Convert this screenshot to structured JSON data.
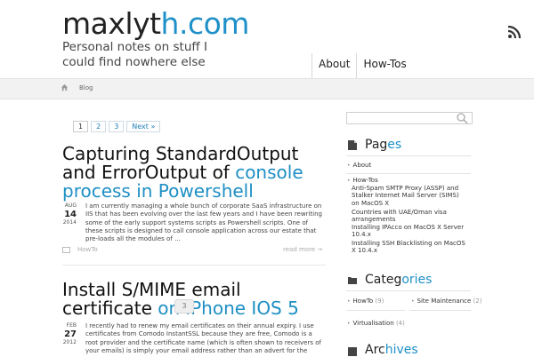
{
  "site": {
    "title_main": "maxlyt",
    "title_accent": "h.com",
    "tagline": "Personal notes on stuff I could find nowhere else"
  },
  "nav": {
    "items": [
      "About",
      "How-Tos"
    ]
  },
  "breadcrumb": {
    "label": "Blog"
  },
  "pagination": {
    "pages": [
      "1",
      "2",
      "3"
    ],
    "next": "Next »"
  },
  "posts": [
    {
      "title_plain": "Capturing StandardOutput and ErrorOutput of ",
      "title_link": "console process in Powershell",
      "month": "AUG",
      "day": "14",
      "year": "2014",
      "excerpt": "I am currently managing a whole bunch of corporate SaaS infrastructure on IIS that has been evolving over the last few years and I have been rewriting some of the early support systems scripts as Powershell scripts. One of these scripts is designed to call console application across our estate that pre-loads all the modules of …",
      "category": "HowTo",
      "read_more": "read more →"
    },
    {
      "title_plain": "Install S/MIME email certificate ",
      "title_link": "on iPhone IOS 5",
      "comments": "3",
      "month": "FEB",
      "day": "27",
      "year": "2012",
      "excerpt": "I recently had to renew my email certificates on their annual expiry. I use certificates from Comodo InstantSSL because they are free, Comodo is a root provider and the certificate name (which is often shown to receivers of your emails) is simply your email address rather than an advert for the"
    }
  ],
  "sidebar": {
    "pages": {
      "title_plain": "Pag",
      "title_accent": "es",
      "items": [
        "About",
        "How-Tos"
      ],
      "subitems": [
        "Anti-Spam SMTP Proxy (ASSP) and Stalker Internet Mail Server (SIMS) on MacOS X",
        "Countries with UAE/Oman visa arrangements",
        "Installing IPAcco on MacOS X Server 10.4.x",
        "Installing SSH Blacklisting on MacOS X 10.4.x"
      ]
    },
    "categories": {
      "title_plain": "Categ",
      "title_accent": "ories",
      "items": [
        {
          "name": "HowTo",
          "count": "(9)"
        },
        {
          "name": "Site Maintenance",
          "count": "(2)"
        },
        {
          "name": "Virtualisation",
          "count": "(4)"
        }
      ]
    },
    "archives": {
      "title_plain": "Arc",
      "title_accent": "hives"
    }
  },
  "colors": {
    "accent": "#1e90c8",
    "rss": "#333333"
  }
}
